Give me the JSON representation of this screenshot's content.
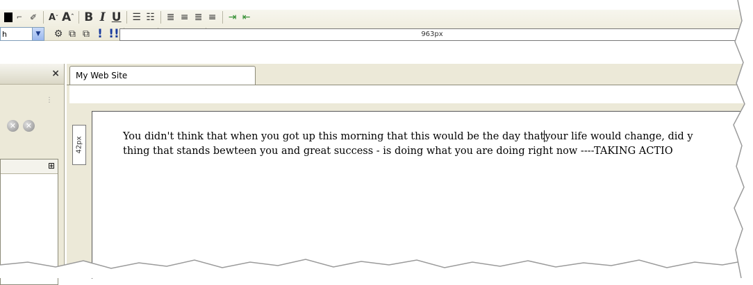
{
  "toolbar": {
    "row1": {
      "pencil_icon": "pencil-icon",
      "decrease_font_icon": "font-decrease-icon",
      "increase_font_icon": "font-increase-icon",
      "bold": "B",
      "italic": "I",
      "underline": "U",
      "ordered_list_icon": "ordered-list-icon",
      "unordered_list_icon": "unordered-list-icon",
      "align_left_icon": "align-left-icon",
      "align_center_icon": "align-center-icon",
      "align_right_icon": "align-right-icon",
      "align_justify_icon": "align-justify-icon",
      "indent_icon": "indent-icon",
      "outdent_icon": "outdent-icon"
    },
    "row2": {
      "font_select_value": "h",
      "exclaim_single": "!",
      "exclaim_double": "!!"
    }
  },
  "left_panel": {
    "close_label": "×"
  },
  "editor": {
    "tab_label": "My Web Site",
    "ruler_width_label": "963px",
    "vertical_ruler_label": "42px",
    "text_line1_before_caret": "You didn't think that when you got up this morning that this would be the day that",
    "text_line1_after_caret": "your life would change, did y",
    "text_line2": "thing that stands bewteen you and great success - is doing what you are doing right now ----TAKING ACTIO"
  },
  "colors": {
    "toolbar_bg": "#ebe8d6",
    "panel_bg": "#ece9d8",
    "select_accent": "#9ab7ee"
  }
}
